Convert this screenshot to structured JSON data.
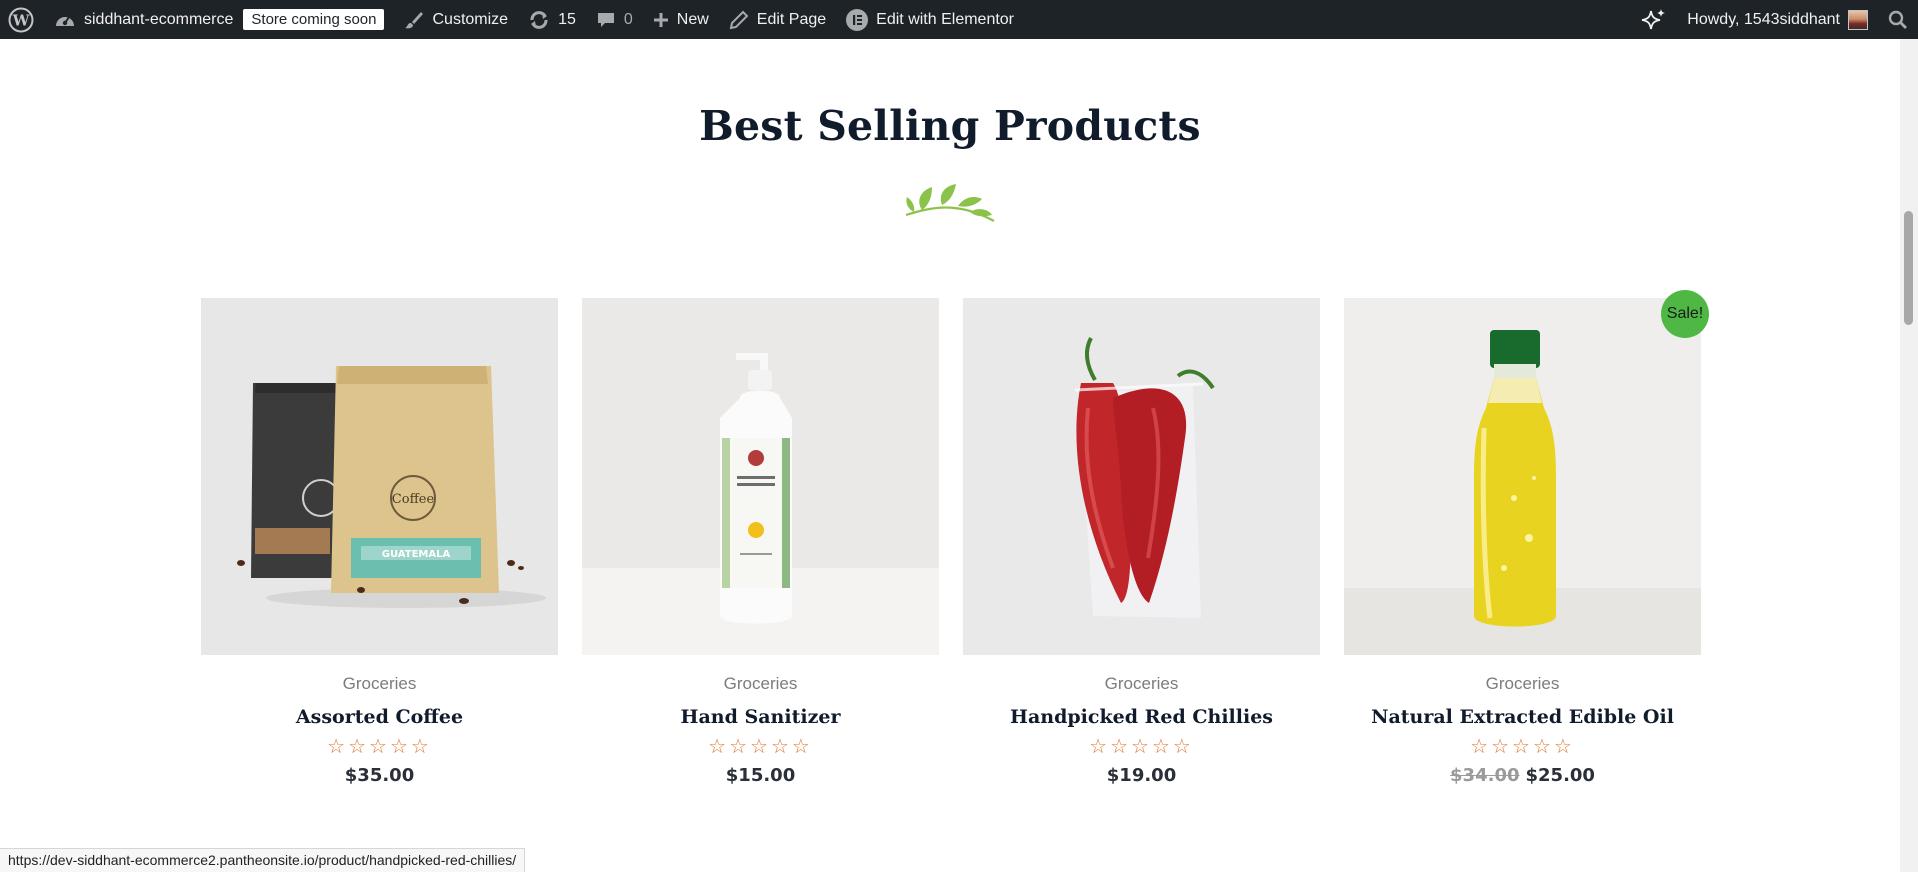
{
  "admin_bar": {
    "site_name": "siddhant-ecommerce",
    "store_badge": "Store coming soon",
    "customize": "Customize",
    "updates_count": "15",
    "comments_count": "0",
    "new": "New",
    "edit_page": "Edit Page",
    "edit_with_elementor": "Edit with Elementor",
    "howdy": "Howdy, 1543siddhant"
  },
  "section": {
    "title": "Best Selling Products"
  },
  "products": [
    {
      "category": "Groceries",
      "name": "Assorted Coffee",
      "rating": "☆☆☆☆☆",
      "price": "$35.00",
      "old_price": ""
    },
    {
      "category": "Groceries",
      "name": "Hand Sanitizer",
      "rating": "☆☆☆☆☆",
      "price": "$15.00",
      "old_price": ""
    },
    {
      "category": "Groceries",
      "name": "Handpicked Red Chillies",
      "rating": "☆☆☆☆☆",
      "price": "$19.00",
      "old_price": ""
    },
    {
      "category": "Groceries",
      "name": "Natural Extracted Edible Oil",
      "rating": "☆☆☆☆☆",
      "price": "$25.00",
      "old_price": "$34.00",
      "badge": "Sale!"
    }
  ],
  "status_url": "https://dev-siddhant-ecommerce2.pantheonsite.io/product/handpicked-red-chillies/",
  "colors": {
    "admin_bar_bg": "#1d2327",
    "star": "#e27730",
    "sale_badge": "#4fb845",
    "heading": "#101b2b",
    "leaf": "#8bc34a"
  },
  "icons": [
    "wordpress-icon",
    "dashboard-icon",
    "brush-icon",
    "updates-icon",
    "comment-icon",
    "plus-icon",
    "pencil-icon",
    "elementor-icon",
    "sparkle-icon",
    "search-icon"
  ]
}
